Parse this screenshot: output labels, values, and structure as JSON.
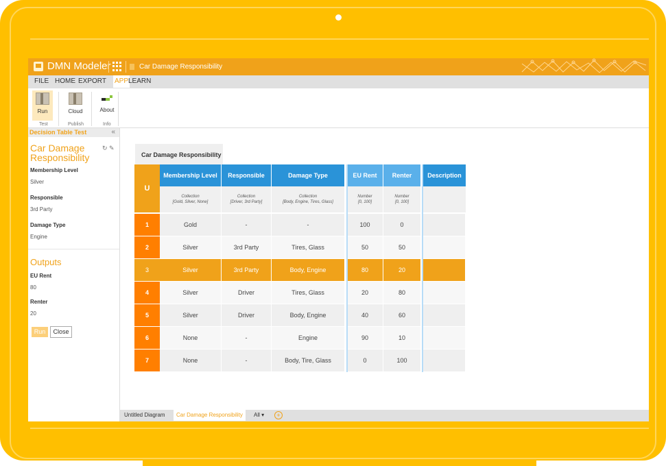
{
  "app": {
    "name": "DMN Modeler",
    "document_title": "Car Damage Responsibility",
    "accent_color": "#f0a21a"
  },
  "menu": [
    "FILE",
    "HOME",
    "EXPORT",
    "APP",
    "LEARN"
  ],
  "ribbon": {
    "buttons": [
      {
        "label": "Run",
        "icon": "box-play-icon"
      },
      {
        "label": "Cloud",
        "icon": "box-cloud-icon"
      },
      {
        "label": "About",
        "icon": "about-icon"
      }
    ],
    "groups": [
      "Test",
      "Publish",
      "Info"
    ]
  },
  "left_panel": {
    "header": "Decision Table Test",
    "collapse": "«",
    "table_name": "Car Damage Responsibility",
    "tools": "↻ ✎",
    "inputs": [
      {
        "label": "Membership Level",
        "value": "Silver"
      },
      {
        "label": "Responsible",
        "value": "3rd Party"
      },
      {
        "label": "Damage Type",
        "value": "Engine"
      }
    ],
    "outputs_title": "Outputs",
    "outputs": [
      {
        "label": "EU Rent",
        "value": "80"
      },
      {
        "label": "Renter",
        "value": "20"
      }
    ],
    "run_label": "Run",
    "close_label": "Close"
  },
  "decision_table": {
    "name": "Car Damage Responsibility",
    "hit_policy": "U",
    "inputs": [
      {
        "header": "Membership Level",
        "type": "Collection",
        "values": "[Gold, Silver, None]"
      },
      {
        "header": "Responsible",
        "type": "Collection",
        "values": "[Driver, 3rd Party]"
      },
      {
        "header": "Damage Type",
        "type": "Collection",
        "values": "[Body, Engine, Tires, Glass]"
      }
    ],
    "outputs": [
      {
        "header": "EU Rent",
        "type": "Number",
        "values": "[0, 100]"
      },
      {
        "header": "Renter",
        "type": "Number",
        "values": "[0, 100]"
      }
    ],
    "annotation_header": "Description",
    "rows": [
      {
        "n": "1",
        "c": [
          "Gold",
          "-",
          "-",
          "100",
          "0",
          ""
        ]
      },
      {
        "n": "2",
        "c": [
          "Silver",
          "3rd Party",
          "Tires, Glass",
          "50",
          "50",
          ""
        ]
      },
      {
        "n": "3",
        "c": [
          "Silver",
          "3rd Party",
          "Body, Engine",
          "80",
          "20",
          ""
        ]
      },
      {
        "n": "4",
        "c": [
          "Silver",
          "Driver",
          "Tires, Glass",
          "20",
          "80",
          ""
        ]
      },
      {
        "n": "5",
        "c": [
          "Silver",
          "Driver",
          "Body, Engine",
          "40",
          "60",
          ""
        ]
      },
      {
        "n": "6",
        "c": [
          "None",
          "-",
          "Engine",
          "90",
          "10",
          ""
        ]
      },
      {
        "n": "7",
        "c": [
          "None",
          "-",
          "Body, Tire, Glass",
          "0",
          "100",
          ""
        ]
      }
    ],
    "highlighted_rule": "3"
  },
  "bottom_tabs": {
    "tabs": [
      "Untitled Diagram",
      "Car Damage Responsibility"
    ],
    "all_label": "All ▾",
    "add_label": "+"
  }
}
